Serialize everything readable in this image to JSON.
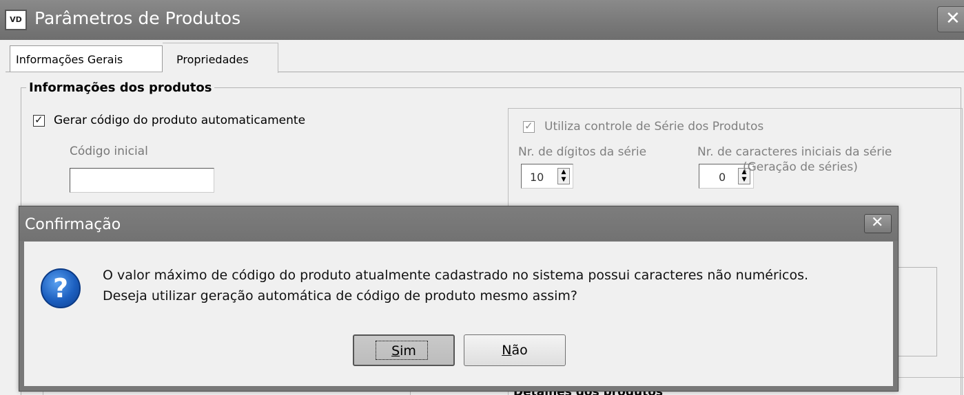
{
  "window": {
    "icon_text": "VD",
    "title": "Parâmetros de Produtos",
    "close_glyph": "✕"
  },
  "tabs": [
    {
      "label": "Informações Gerais",
      "active": true
    },
    {
      "label": "Propriedades",
      "active": false
    }
  ],
  "group": {
    "legend": "Informações dos produtos",
    "gen_code_label": "Gerar código do produto automaticamente",
    "gen_code_checked": true,
    "initial_code_label": "Código inicial",
    "initial_code_value": ""
  },
  "series": {
    "checkbox_label": "Utiliza controle de Série dos Produtos",
    "checked": true,
    "digits_label": "Nr. de dígitos da série",
    "digits_value": "10",
    "initial_chars_label": "Nr. de caracteres iniciais da série",
    "initial_chars_value": "0",
    "generation_label": "(Geração de séries)"
  },
  "bottom_section_label": "Detalhes dos produtos",
  "dialog": {
    "title": "Confirmação",
    "close_glyph": "✕",
    "icon": "question-icon",
    "message_line1": "O valor máximo de código do produto atualmente cadastrado no sistema possui caracteres não numéricos.",
    "message_line2": "Deseja utilizar geração automática de código de produto mesmo assim?",
    "yes_button": {
      "underlined": "S",
      "rest": "im"
    },
    "no_button": {
      "underlined": "N",
      "rest": "ão"
    }
  }
}
